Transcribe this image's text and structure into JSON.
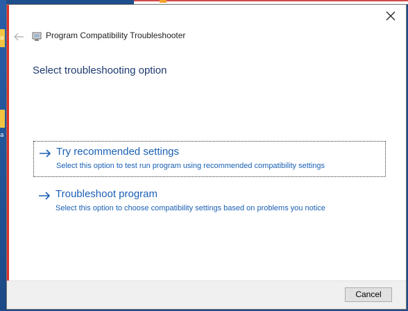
{
  "desktop": {
    "labels": [
      "a",
      "a"
    ]
  },
  "window": {
    "title": "Program Compatibility Troubleshooter",
    "heading": "Select troubleshooting option",
    "options": [
      {
        "title": "Try recommended settings",
        "description": "Select this option to test run program using recommended compatibility settings"
      },
      {
        "title": "Troubleshoot program",
        "description": "Select this option to choose compatibility settings based on problems you notice"
      }
    ],
    "cancel_label": "Cancel"
  },
  "icons": {
    "close": "close-icon",
    "back": "back-arrow-icon",
    "app": "troubleshooter-icon",
    "option_arrow": "arrow-right-icon"
  },
  "colors": {
    "link": "#1a5fb4",
    "heading": "#1e3a6e",
    "footer": "#f0f0f0"
  }
}
